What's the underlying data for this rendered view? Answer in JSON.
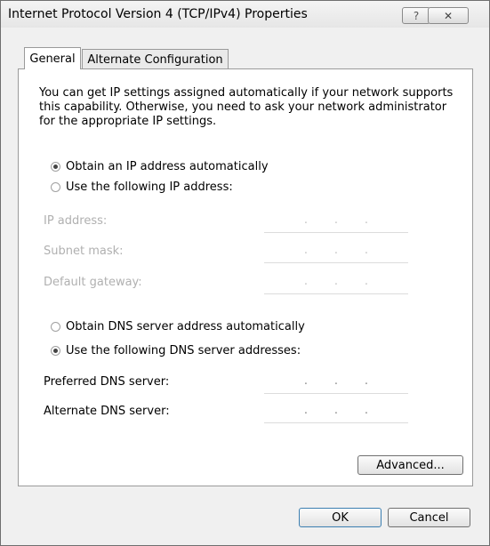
{
  "window": {
    "title": "Internet Protocol Version 4 (TCP/IPv4) Properties",
    "help_label": "?",
    "close_label": "✕"
  },
  "tabs": [
    {
      "label": "General",
      "selected": true
    },
    {
      "label": "Alternate Configuration",
      "selected": false
    }
  ],
  "description": "You can get IP settings assigned automatically if your network supports this capability. Otherwise, you need to ask your network administrator for the appropriate IP settings.",
  "ip_mode": {
    "auto_label": "Obtain an IP address automatically",
    "manual_label": "Use the following IP address:",
    "selected": "auto"
  },
  "ip_fields": {
    "ip_address_label": "IP address:",
    "subnet_mask_label": "Subnet mask:",
    "default_gateway_label": "Default gateway:"
  },
  "dns_mode": {
    "auto_label": "Obtain DNS server address automatically",
    "manual_label": "Use the following DNS server addresses:",
    "selected": "manual"
  },
  "dns_fields": {
    "preferred_label": "Preferred DNS server:",
    "alternate_label": "Alternate DNS server:"
  },
  "ip_dots": ".",
  "buttons": {
    "advanced": "Advanced...",
    "ok": "OK",
    "cancel": "Cancel"
  },
  "colors": {
    "window_bg": "#f0f0f0",
    "panel_bg": "#ffffff",
    "disabled_text": "#b0b0b0",
    "default_button_border": "#3c7fb1"
  }
}
